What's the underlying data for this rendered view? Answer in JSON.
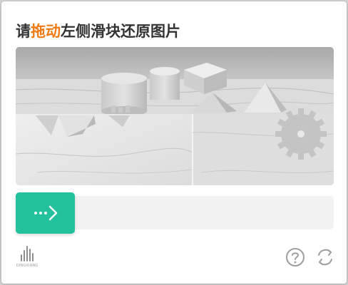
{
  "dialog": {
    "title_before": "请",
    "title_highlight": "拖动",
    "title_after": "左侧滑块还原图片"
  },
  "slider": {
    "handle_icon": "dots-arrow-right-icon",
    "progress": 0
  },
  "footer": {
    "brand_text": "DINGXIANG",
    "logo_icon": "dingxiang-logo",
    "help_icon": "question-circle-icon",
    "refresh_icon": "refresh-icon"
  },
  "colors": {
    "accent": "#24c19d",
    "highlight": "#f07b14",
    "title": "#333333",
    "track": "#f2f2f2"
  }
}
